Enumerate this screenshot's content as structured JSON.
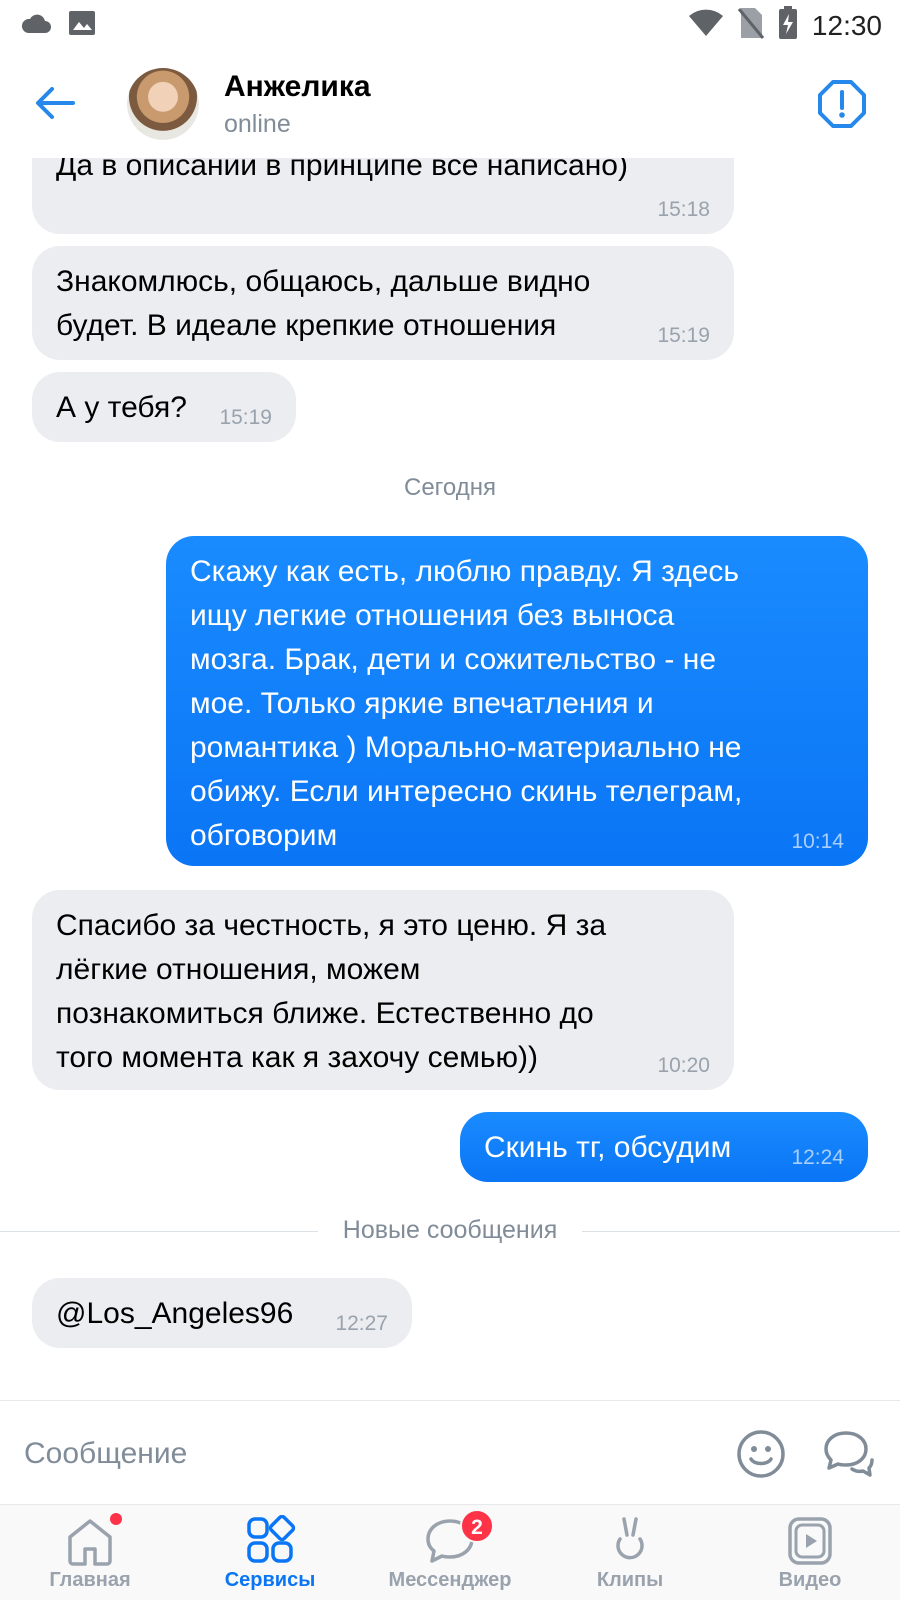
{
  "status_bar": {
    "time": "12:30",
    "icons": [
      "cloud-icon",
      "image-icon",
      "wifi-icon",
      "no-sim-icon",
      "battery-charging-icon"
    ]
  },
  "header": {
    "contact_name": "Анжелика",
    "contact_status": "online",
    "icons": [
      "back-arrow-icon",
      "avatar",
      "report-alert-icon"
    ]
  },
  "messages": [
    {
      "dir": "in",
      "text": "Да в описании в принципе все написано)",
      "time": "15:18"
    },
    {
      "dir": "in",
      "text": "Знакомлюсь, общаюсь, дальше видно\nбудет. В идеале крепкие отношения",
      "time": "15:19"
    },
    {
      "dir": "in",
      "text": "А у тебя?",
      "time": "15:19"
    },
    {
      "dir": "out",
      "text": "Скажу как есть, люблю правду. Я здесь\nищу легкие отношения без выноса\nмозга. Брак, дети и сожительство - не\nмое. Только яркие впечатления и\nромантика ) Морально-материально не\nобижу. Если интересно скинь телеграм,\nобговорим",
      "time": "10:14"
    },
    {
      "dir": "in",
      "text": "Спасибо за честность, я это ценю. Я за\nлёгкие отношения, можем\nпознакомиться ближе. Естественно до\nтого момента как я захочу семью))",
      "time": "10:20"
    },
    {
      "dir": "out",
      "text": "Скинь тг, обсудим",
      "time": "12:24"
    },
    {
      "dir": "in",
      "text": "@Los_Angeles96",
      "time": "12:27"
    }
  ],
  "separators": {
    "date": "Сегодня",
    "new_messages": "Новые сообщения"
  },
  "composer": {
    "placeholder": "Сообщение",
    "icons": [
      "emoji-icon",
      "voice-message-icon"
    ]
  },
  "bottom_nav": {
    "items": [
      {
        "label": "Главная",
        "icon": "home-icon",
        "active": false,
        "dot": true
      },
      {
        "label": "Сервисы",
        "icon": "services-icon",
        "active": true
      },
      {
        "label": "Мессенджер",
        "icon": "messenger-icon",
        "active": false,
        "badge": "2"
      },
      {
        "label": "Клипы",
        "icon": "clips-icon",
        "active": false
      },
      {
        "label": "Видео",
        "icon": "video-icon",
        "active": false
      }
    ]
  },
  "colors": {
    "accent": "#0a75f5",
    "incoming_bubble": "#ebedf0",
    "secondary_text": "#818c99",
    "badge": "#ff3347"
  }
}
